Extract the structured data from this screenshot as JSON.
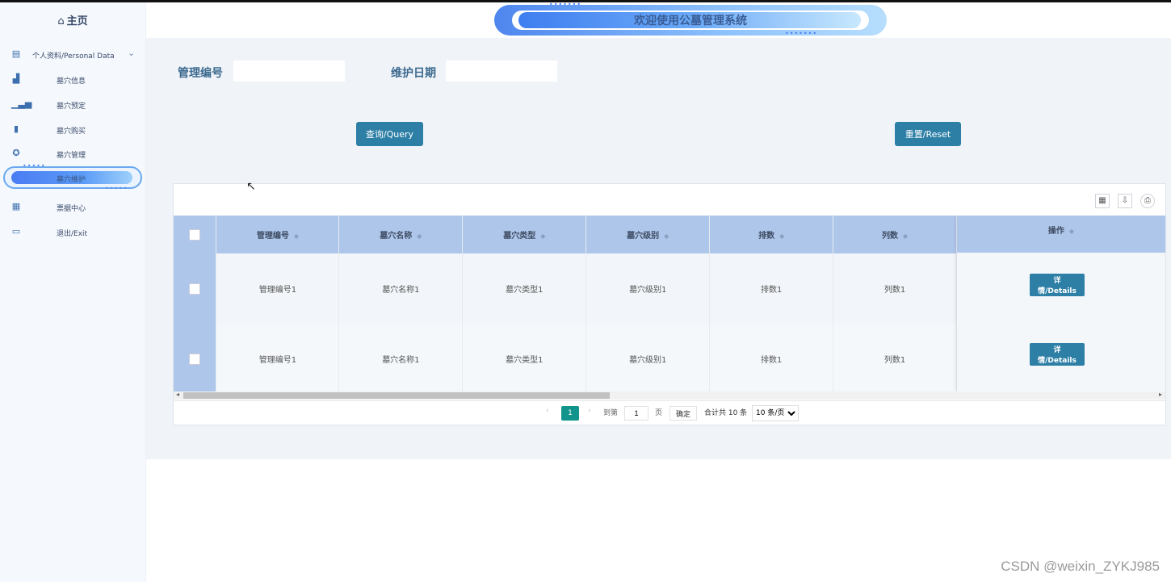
{
  "header": {
    "title": "欢迎使用公墓管理系统"
  },
  "sidebar": {
    "home": "主页",
    "parent": "个人资料/Personal Data",
    "items": [
      {
        "label": "墓穴信息",
        "icon": "building-icon"
      },
      {
        "label": "墓穴预定",
        "icon": "chart-icon"
      },
      {
        "label": "墓穴购买",
        "icon": "bookmark-icon"
      },
      {
        "label": "墓穴管理",
        "icon": "badge-icon"
      },
      {
        "label": "墓穴维护",
        "icon": "",
        "active": true
      },
      {
        "label": "票据中心",
        "icon": "calendar-check-icon"
      },
      {
        "label": "退出/Exit",
        "icon": "book-icon"
      }
    ]
  },
  "search": {
    "field1_label": "管理编号",
    "field1_value": "",
    "field2_label": "维护日期",
    "field2_value": "",
    "query_label": "查询/Query",
    "reset_label": "重置/Reset"
  },
  "table": {
    "columns": [
      "管理编号",
      "墓穴名称",
      "墓穴类型",
      "墓穴级别",
      "排数",
      "列数"
    ],
    "op_column": "操作",
    "rows": [
      [
        "管理编号1",
        "墓穴名称1",
        "墓穴类型1",
        "墓穴级别1",
        "排数1",
        "列数1"
      ],
      [
        "管理编号1",
        "墓穴名称1",
        "墓穴类型1",
        "墓穴级别1",
        "排数1",
        "列数1"
      ]
    ],
    "detail_label": "详情/Details"
  },
  "pager": {
    "current_page": "1",
    "goto_prefix": "到第",
    "goto_value": "1",
    "page_suffix": "页",
    "confirm_label": "确定",
    "total_text": "合计共 10 条",
    "page_size": "10 条/页"
  },
  "watermark": "CSDN @weixin_ZYKJ985"
}
